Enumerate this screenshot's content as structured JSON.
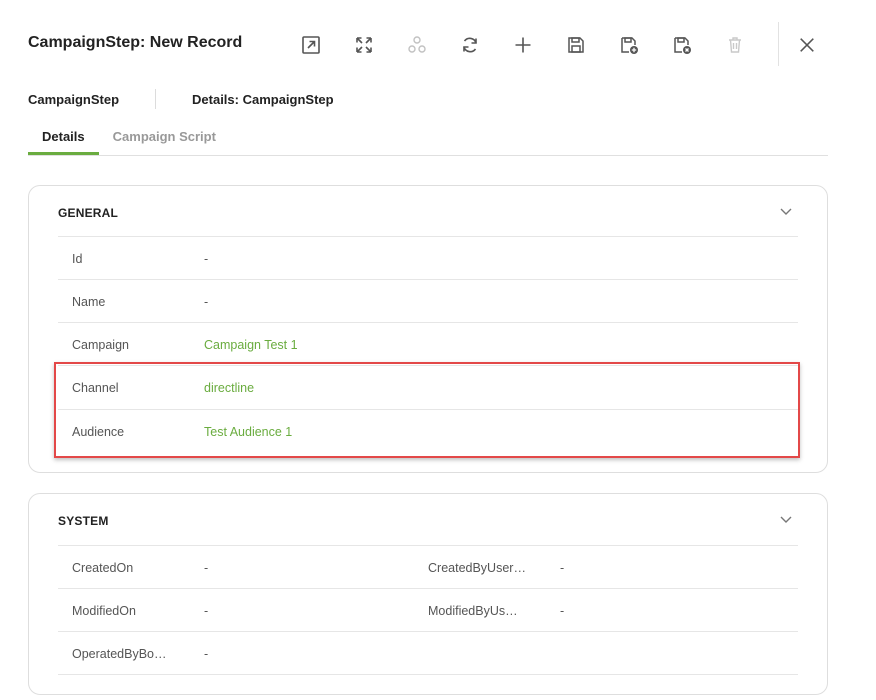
{
  "header": {
    "title": "CampaignStep: New Record"
  },
  "toolbar": {
    "buttons": [
      {
        "icon": "open-external-icon",
        "enabled": true
      },
      {
        "icon": "expand-icon",
        "enabled": true
      },
      {
        "icon": "relations-icon",
        "enabled": false
      },
      {
        "icon": "refresh-icon",
        "enabled": true
      },
      {
        "icon": "add-icon",
        "enabled": true
      },
      {
        "icon": "save-icon",
        "enabled": true
      },
      {
        "icon": "save-new-icon",
        "enabled": true
      },
      {
        "icon": "save-close-icon",
        "enabled": true
      },
      {
        "icon": "delete-icon",
        "enabled": false
      }
    ],
    "close_icon": "close-icon"
  },
  "breadcrumb": {
    "entity": "CampaignStep",
    "details": "Details: CampaignStep"
  },
  "tabs": [
    {
      "label": "Details",
      "active": true
    },
    {
      "label": "Campaign Script",
      "active": false
    }
  ],
  "general": {
    "title": "GENERAL",
    "rows": [
      {
        "label": "Id",
        "value": "-",
        "link": false
      },
      {
        "label": "Name",
        "value": "-",
        "link": false
      },
      {
        "label": "Campaign",
        "value": "Campaign Test 1",
        "link": true
      },
      {
        "label": "Channel",
        "value": "directline",
        "link": true
      },
      {
        "label": "Audience",
        "value": "Test Audience 1",
        "link": true
      }
    ]
  },
  "system": {
    "title": "SYSTEM",
    "rows": [
      {
        "label": "CreatedOn",
        "value": "-",
        "label2": "CreatedByUser…",
        "value2": "-"
      },
      {
        "label": "ModifiedOn",
        "value": "-",
        "label2": "ModifiedByUs…",
        "value2": "-"
      },
      {
        "label": "OperatedByBo…",
        "value": "-"
      }
    ]
  },
  "colors": {
    "accent": "#6aac3f",
    "highlight": "#e34848"
  }
}
